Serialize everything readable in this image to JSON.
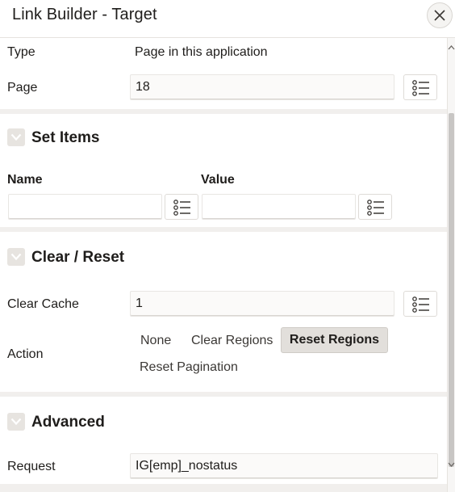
{
  "dialog": {
    "title": "Link Builder - Target"
  },
  "target": {
    "type_label": "Type",
    "type_value": "Page in this application",
    "page_label": "Page",
    "page_value": "18"
  },
  "set_items": {
    "title": "Set Items",
    "name_header": "Name",
    "value_header": "Value",
    "name_value": "",
    "value_value": ""
  },
  "clear_reset": {
    "title": "Clear / Reset",
    "clear_cache_label": "Clear Cache",
    "clear_cache_value": "1",
    "action_label": "Action",
    "actions": [
      "None",
      "Clear Regions",
      "Reset Regions",
      "Reset Pagination"
    ],
    "selected_action": "Reset Regions"
  },
  "advanced": {
    "title": "Advanced",
    "request_label": "Request",
    "request_value": "IG[emp]_nostatus"
  }
}
